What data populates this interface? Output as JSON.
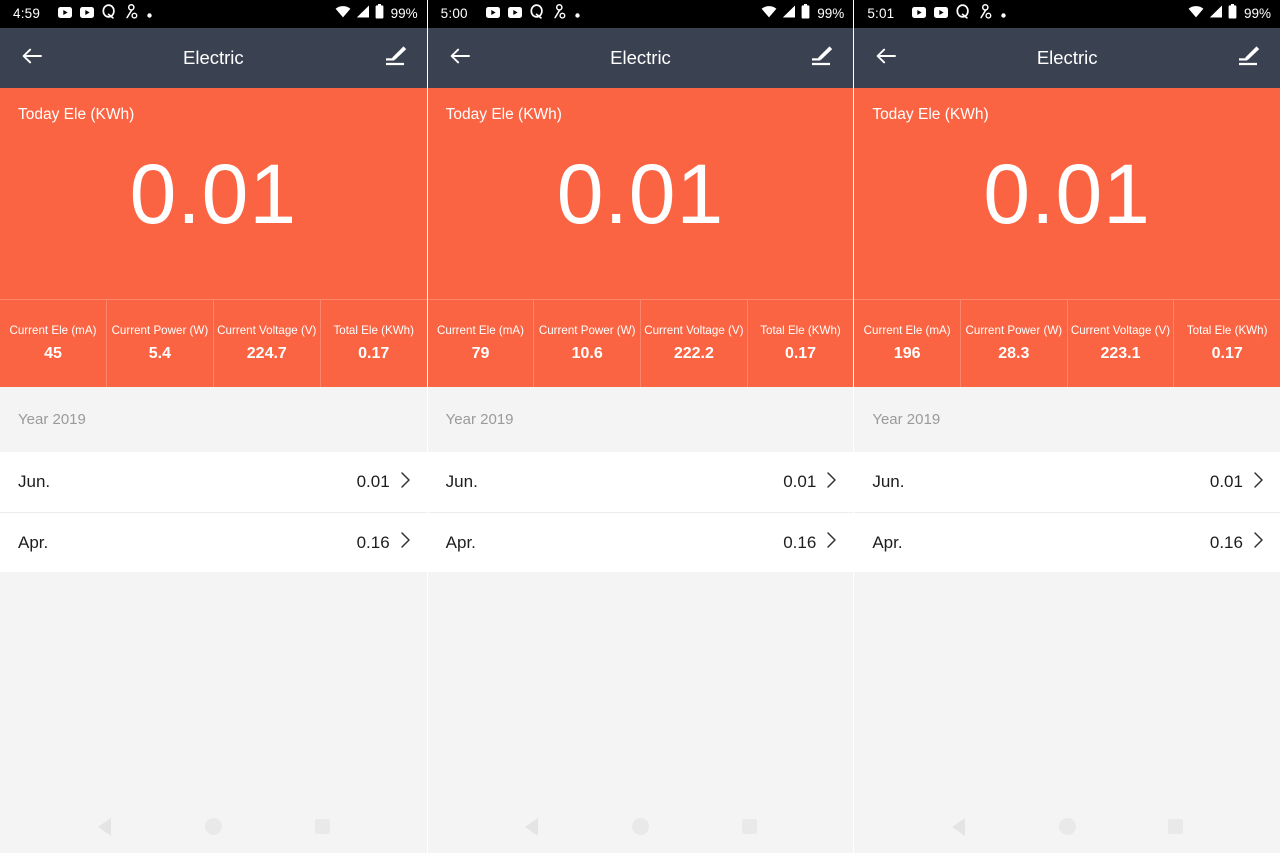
{
  "screens": [
    {
      "statusbar": {
        "time": "4:59",
        "battery_percent": "99%",
        "left_icons": [
          "youtube-icon",
          "youtube-icon",
          "quora-icon",
          "person-search-icon",
          "dot-icon"
        ],
        "right_icons": [
          "wifi-icon",
          "signal-icon",
          "battery-icon"
        ]
      },
      "appbar": {
        "back_icon": "back-arrow-icon",
        "title": "Electric",
        "edit_icon": "edit-pencil-icon"
      },
      "hero": {
        "label": "Today Ele (KWh)",
        "value": "0.01"
      },
      "metrics": [
        {
          "label": "Current Ele (mA)",
          "value": "45"
        },
        {
          "label": "Current Power (W)",
          "value": "5.4"
        },
        {
          "label": "Current Voltage (V)",
          "value": "224.7"
        },
        {
          "label": "Total Ele (KWh)",
          "value": "0.17"
        }
      ],
      "list": {
        "year_header": "Year 2019",
        "rows": [
          {
            "label": "Jun.",
            "value": "0.01",
            "chevron": "chevron-right-icon"
          },
          {
            "label": "Apr.",
            "value": "0.16",
            "chevron": "chevron-right-icon"
          }
        ]
      },
      "navbar": {
        "back": "nav-back-icon",
        "home": "nav-home-icon",
        "recents": "nav-recents-icon"
      }
    },
    {
      "statusbar": {
        "time": "5:00",
        "battery_percent": "99%",
        "left_icons": [
          "youtube-icon",
          "youtube-icon",
          "quora-icon",
          "person-search-icon",
          "dot-icon"
        ],
        "right_icons": [
          "wifi-icon",
          "signal-icon",
          "battery-icon"
        ]
      },
      "appbar": {
        "back_icon": "back-arrow-icon",
        "title": "Electric",
        "edit_icon": "edit-pencil-icon"
      },
      "hero": {
        "label": "Today Ele (KWh)",
        "value": "0.01"
      },
      "metrics": [
        {
          "label": "Current Ele (mA)",
          "value": "79"
        },
        {
          "label": "Current Power (W)",
          "value": "10.6"
        },
        {
          "label": "Current Voltage (V)",
          "value": "222.2"
        },
        {
          "label": "Total Ele (KWh)",
          "value": "0.17"
        }
      ],
      "list": {
        "year_header": "Year 2019",
        "rows": [
          {
            "label": "Jun.",
            "value": "0.01",
            "chevron": "chevron-right-icon"
          },
          {
            "label": "Apr.",
            "value": "0.16",
            "chevron": "chevron-right-icon"
          }
        ]
      },
      "navbar": {
        "back": "nav-back-icon",
        "home": "nav-home-icon",
        "recents": "nav-recents-icon"
      }
    },
    {
      "statusbar": {
        "time": "5:01",
        "battery_percent": "99%",
        "left_icons": [
          "youtube-icon",
          "youtube-icon",
          "quora-icon",
          "person-search-icon",
          "dot-icon"
        ],
        "right_icons": [
          "wifi-icon",
          "signal-icon",
          "battery-icon"
        ]
      },
      "appbar": {
        "back_icon": "back-arrow-icon",
        "title": "Electric",
        "edit_icon": "edit-pencil-icon"
      },
      "hero": {
        "label": "Today Ele (KWh)",
        "value": "0.01"
      },
      "metrics": [
        {
          "label": "Current Ele (mA)",
          "value": "196"
        },
        {
          "label": "Current Power (W)",
          "value": "28.3"
        },
        {
          "label": "Current Voltage (V)",
          "value": "223.1"
        },
        {
          "label": "Total Ele (KWh)",
          "value": "0.17"
        }
      ],
      "list": {
        "year_header": "Year 2019",
        "rows": [
          {
            "label": "Jun.",
            "value": "0.01",
            "chevron": "chevron-right-icon"
          },
          {
            "label": "Apr.",
            "value": "0.16",
            "chevron": "chevron-right-icon"
          }
        ]
      },
      "navbar": {
        "back": "nav-back-icon",
        "home": "nav-home-icon",
        "recents": "nav-recents-icon"
      }
    }
  ],
  "colors": {
    "accent_orange": "#fb6442",
    "appbar_navy": "#3a4252",
    "statusbar_black": "#000000",
    "page_background": "#f4f4f4",
    "row_background": "#ffffff",
    "muted_text": "#9a9a9a"
  }
}
